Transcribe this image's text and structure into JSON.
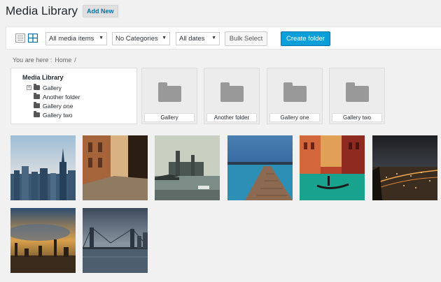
{
  "header": {
    "title": "Media Library",
    "add_new_label": "Add New"
  },
  "toolbar": {
    "view_list_icon": "list-view-icon",
    "view_grid_icon": "grid-view-icon",
    "media_filter": "All media items",
    "category_filter": "No Categories",
    "date_filter": "All dates",
    "bulk_select_label": "Bulk Select",
    "create_folder_label": "Create folder",
    "accent_color": "#0a9fd8"
  },
  "breadcrumb": {
    "prefix": "You are here :",
    "home": "Home",
    "separator": "/"
  },
  "tree": {
    "root": "Media Library",
    "items": [
      {
        "label": "Gallery",
        "expandable": true
      },
      {
        "label": "Another folder",
        "expandable": false
      },
      {
        "label": "Gallery one",
        "expandable": false
      },
      {
        "label": "Gallery two",
        "expandable": false
      }
    ]
  },
  "folders": [
    {
      "label": "Gallery"
    },
    {
      "label": "Another folder"
    },
    {
      "label": "Gallery one"
    },
    {
      "label": "Gallery two"
    }
  ],
  "media_items": [
    {
      "name": "city-skyline-photo"
    },
    {
      "name": "old-town-street-photo"
    },
    {
      "name": "parliament-river-photo"
    },
    {
      "name": "pier-lake-photo"
    },
    {
      "name": "venice-canal-photo"
    },
    {
      "name": "city-night-photo"
    },
    {
      "name": "sunset-skyline-photo"
    },
    {
      "name": "bridge-skyline-photo"
    }
  ]
}
